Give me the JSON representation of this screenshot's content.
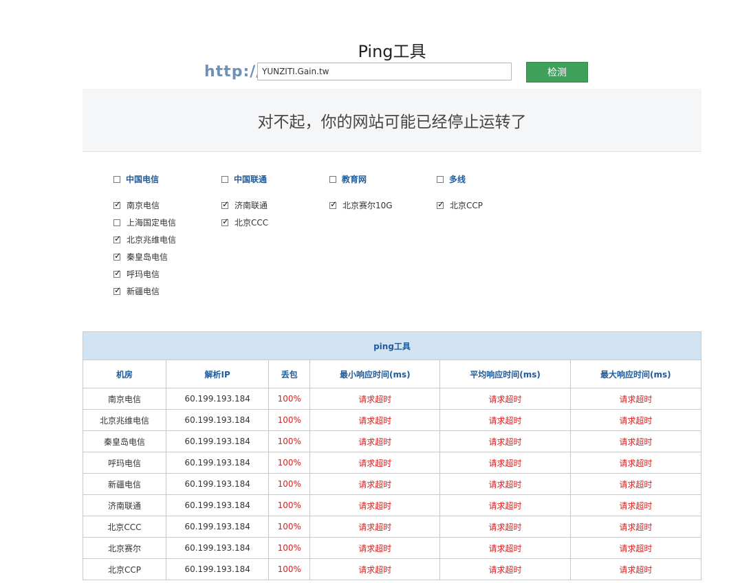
{
  "page": {
    "title": "Ping工具"
  },
  "url_bar": {
    "prefix": "http://",
    "value": "YUNZITI.Gain.tw",
    "button_label": "检测"
  },
  "message": "对不起，你的网站可能已经停止运转了",
  "groups": [
    {
      "name": "中国电信",
      "checked": false,
      "items": [
        {
          "label": "南京电信",
          "checked": true
        },
        {
          "label": "上海国定电信",
          "checked": false
        },
        {
          "label": "北京兆维电信",
          "checked": true
        },
        {
          "label": "秦皇岛电信",
          "checked": true
        },
        {
          "label": "呼玛电信",
          "checked": true
        },
        {
          "label": "新疆电信",
          "checked": true
        }
      ]
    },
    {
      "name": "中国联通",
      "checked": false,
      "items": [
        {
          "label": "济南联通",
          "checked": true
        },
        {
          "label": "北京CCC",
          "checked": true
        }
      ]
    },
    {
      "name": "教育网",
      "checked": false,
      "items": [
        {
          "label": "北京赛尔10G",
          "checked": true
        }
      ]
    },
    {
      "name": "多线",
      "checked": false,
      "items": [
        {
          "label": "北京CCP",
          "checked": true
        }
      ]
    }
  ],
  "results": {
    "caption": "ping工具",
    "columns": [
      "机房",
      "解析IP",
      "丢包",
      "最小响应时间(ms)",
      "平均响应时间(ms)",
      "最大响应时间(ms)"
    ],
    "rows": [
      [
        "南京电信",
        "60.199.193.184",
        "100%",
        "请求超时",
        "请求超时",
        "请求超时"
      ],
      [
        "北京兆维电信",
        "60.199.193.184",
        "100%",
        "请求超时",
        "请求超时",
        "请求超时"
      ],
      [
        "秦皇岛电信",
        "60.199.193.184",
        "100%",
        "请求超时",
        "请求超时",
        "请求超时"
      ],
      [
        "呼玛电信",
        "60.199.193.184",
        "100%",
        "请求超时",
        "请求超时",
        "请求超时"
      ],
      [
        "新疆电信",
        "60.199.193.184",
        "100%",
        "请求超时",
        "请求超时",
        "请求超时"
      ],
      [
        "济南联通",
        "60.199.193.184",
        "100%",
        "请求超时",
        "请求超时",
        "请求超时"
      ],
      [
        "北京CCC",
        "60.199.193.184",
        "100%",
        "请求超时",
        "请求超时",
        "请求超时"
      ],
      [
        "北京赛尔",
        "60.199.193.184",
        "100%",
        "请求超时",
        "请求超时",
        "请求超时"
      ],
      [
        "北京CCP",
        "60.199.193.184",
        "100%",
        "请求超时",
        "请求超时",
        "请求超时"
      ]
    ]
  },
  "colors": {
    "accent": "#1e5b9c",
    "button": "#3fa05a",
    "error": "#d81e1e",
    "table_caption_bg": "#d2e4f3"
  }
}
